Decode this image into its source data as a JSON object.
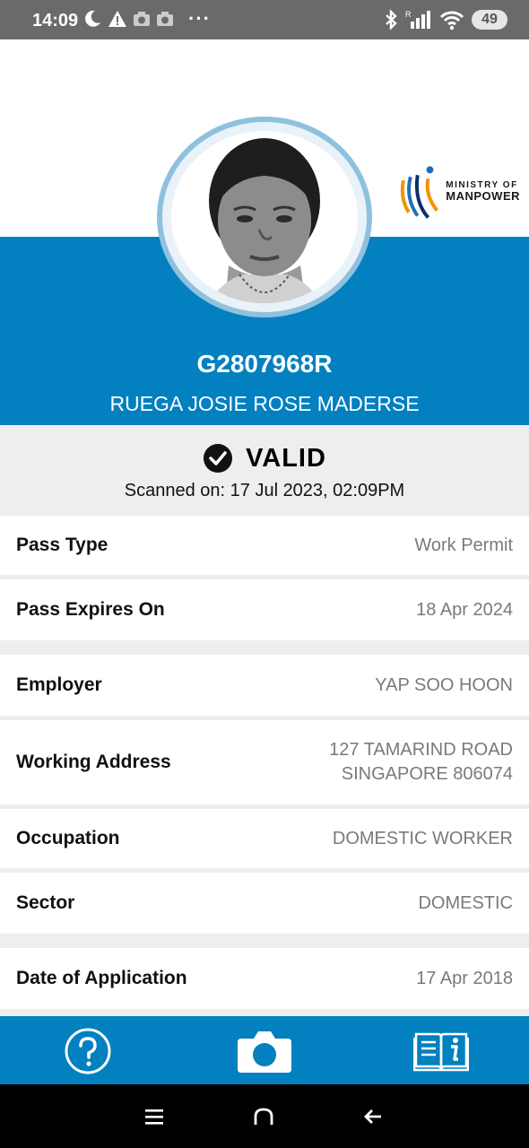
{
  "status_bar": {
    "time": "14:09",
    "battery": "49",
    "overflow": "···"
  },
  "header": {
    "logo_line1": "MINISTRY OF",
    "logo_line2": "MANPOWER",
    "pass_id": "G2807968R",
    "holder_name": "RUEGA JOSIE ROSE MADERSE",
    "accent_color": "#0280bf"
  },
  "validity": {
    "status": "VALID",
    "scanned": "Scanned on: 17 Jul 2023, 02:09PM"
  },
  "details": [
    {
      "label": "Pass Type",
      "value": "Work Permit"
    },
    {
      "label": "Pass Expires On",
      "value": "18 Apr 2024"
    },
    {
      "label": "Employer",
      "value": "YAP SOO HOON"
    },
    {
      "label": "Working Address",
      "value_line1": "127 TAMARIND ROAD",
      "value_line2": "SINGAPORE 806074"
    },
    {
      "label": "Occupation",
      "value": "DOMESTIC WORKER"
    },
    {
      "label": "Sector",
      "value": "DOMESTIC"
    },
    {
      "label": "Date of Application",
      "value": "17 Apr 2018"
    }
  ],
  "tabs": {
    "help": "help-icon",
    "scan": "camera-icon",
    "guide": "info-book-icon"
  }
}
